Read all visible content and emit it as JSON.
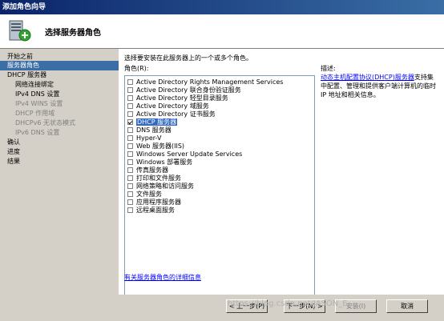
{
  "window": {
    "title": "添加角色向导"
  },
  "header": {
    "title": "选择服务器角色"
  },
  "sidebar": {
    "items": [
      {
        "label": "开始之前",
        "indent": 0,
        "state": "normal"
      },
      {
        "label": "服务器角色",
        "indent": 0,
        "state": "active"
      },
      {
        "label": "DHCP 服务器",
        "indent": 0,
        "state": "normal"
      },
      {
        "label": "网络连接绑定",
        "indent": 1,
        "state": "normal"
      },
      {
        "label": "IPv4 DNS 设置",
        "indent": 1,
        "state": "normal"
      },
      {
        "label": "IPv4 WINS 设置",
        "indent": 1,
        "state": "disabled"
      },
      {
        "label": "DHCP 作用域",
        "indent": 1,
        "state": "disabled"
      },
      {
        "label": "DHCPv6 无状态模式",
        "indent": 1,
        "state": "disabled"
      },
      {
        "label": "IPv6 DNS 设置",
        "indent": 1,
        "state": "disabled"
      },
      {
        "label": "确认",
        "indent": 0,
        "state": "normal"
      },
      {
        "label": "进度",
        "indent": 0,
        "state": "normal"
      },
      {
        "label": "结果",
        "indent": 0,
        "state": "normal"
      }
    ]
  },
  "main": {
    "instruction": "选择要安装在此服务器上的一个或多个角色。",
    "roles_label": "角色(R):",
    "roles": [
      {
        "label": "Active Directory Rights Management Services",
        "checked": false,
        "selected": false
      },
      {
        "label": "Active Directory 联合身份验证服务",
        "checked": false,
        "selected": false
      },
      {
        "label": "Active Directory 轻型目录服务",
        "checked": false,
        "selected": false
      },
      {
        "label": "Active Directory 域服务",
        "checked": false,
        "selected": false
      },
      {
        "label": "Active Directory 证书服务",
        "checked": false,
        "selected": false
      },
      {
        "label": "DHCP 服务器",
        "checked": true,
        "selected": true
      },
      {
        "label": "DNS 服务器",
        "checked": false,
        "selected": false
      },
      {
        "label": "Hyper-V",
        "checked": false,
        "selected": false
      },
      {
        "label": "Web 服务器(IIS)",
        "checked": false,
        "selected": false
      },
      {
        "label": "Windows Server Update Services",
        "checked": false,
        "selected": false
      },
      {
        "label": "Windows 部署服务",
        "checked": false,
        "selected": false
      },
      {
        "label": "传真服务器",
        "checked": false,
        "selected": false
      },
      {
        "label": "打印和文件服务",
        "checked": false,
        "selected": false
      },
      {
        "label": "网络策略和访问服务",
        "checked": false,
        "selected": false
      },
      {
        "label": "文件服务",
        "checked": false,
        "selected": false
      },
      {
        "label": "应用程序服务器",
        "checked": false,
        "selected": false
      },
      {
        "label": "远程桌面服务",
        "checked": false,
        "selected": false
      }
    ],
    "description_label": "描述:",
    "description_link": "动态主机配置协议(DHCP)服务器",
    "description_text": "支持集中配置、管理和提供客户端计算机的临时 IP 地址和相关信息。",
    "more_info_link": "有关服务器角色的详细信息"
  },
  "buttons": {
    "prev": "< 上一步(P)",
    "next": "下一步(N) >",
    "install": "安装(I)",
    "cancel": "取消"
  },
  "watermark": "https://blog.csdn.net/JASON_E"
}
